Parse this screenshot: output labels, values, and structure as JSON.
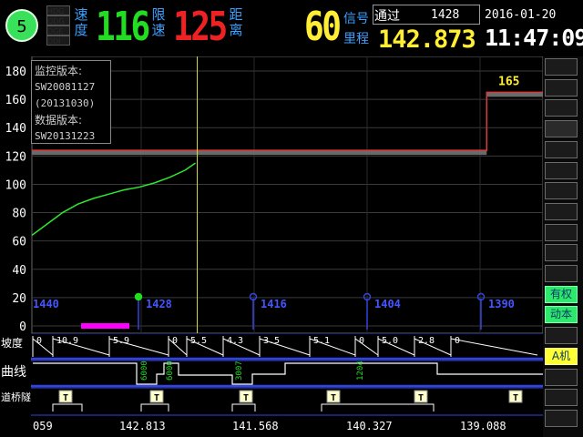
{
  "header": {
    "status_number": "5",
    "mini_labels": [
      "HDG",
      "ODG",
      "DGE",
      "DDI"
    ],
    "speed_label": "速度",
    "speed_value": "116",
    "limit_label": "限速",
    "limit_value": "125",
    "distance_label": "距离",
    "distance_value": "60",
    "signal_label": "信号",
    "mileage_label": "里程",
    "pass_label": "通过",
    "pass_value": "1428",
    "mileage_value": "142.873",
    "date": "2016-01-20",
    "time": "11:47:09"
  },
  "version_box": {
    "line1": "监控版本:",
    "line2": "SW20081127",
    "line3": "(20131030)",
    "line4": "数据版本:",
    "line5": "SW20131223"
  },
  "chart_data": {
    "type": "line",
    "y_ticks": [
      "180",
      "160",
      "140",
      "120",
      "100",
      "80",
      "60",
      "40",
      "20",
      "0"
    ],
    "ylim": [
      0,
      180
    ],
    "grid": true,
    "x_ticks": [
      "059",
      "142.813",
      "141.568",
      "140.327",
      "139.088"
    ],
    "speed_limit_label": "165",
    "signals": [
      "1440",
      "1428",
      "1416",
      "1404",
      "1390"
    ],
    "series": [
      {
        "color": "#d93b3b",
        "values": [
          {
            "x": 0,
            "y": 124
          },
          {
            "x": 0.89,
            "y": 124
          },
          {
            "x": 0.89,
            "y": 165
          },
          {
            "x": 1.0,
            "y": 165
          }
        ]
      },
      {
        "color": "#2ee82e",
        "values": [
          {
            "x": 0,
            "y": 64
          },
          {
            "x": 0.03,
            "y": 72
          },
          {
            "x": 0.06,
            "y": 80
          },
          {
            "x": 0.09,
            "y": 86
          },
          {
            "x": 0.12,
            "y": 90
          },
          {
            "x": 0.15,
            "y": 93
          },
          {
            "x": 0.18,
            "y": 96
          },
          {
            "x": 0.21,
            "y": 98
          },
          {
            "x": 0.24,
            "y": 101
          },
          {
            "x": 0.27,
            "y": 105
          },
          {
            "x": 0.3,
            "y": 110
          },
          {
            "x": 0.32,
            "y": 115
          }
        ]
      }
    ]
  },
  "tracks": {
    "label1": "坡度",
    "label2": "曲线",
    "label3": "道桥隧",
    "grade_values": [
      "0",
      "10.9",
      "5.9",
      "0",
      "5.5",
      "4.3",
      "3.5",
      "5.1",
      "0",
      "5.0",
      "2.8",
      "0"
    ],
    "curve_values": [
      "6000",
      "6000",
      "3007",
      "1204"
    ]
  },
  "sidebar": {
    "items": [
      "",
      "",
      "",
      "",
      "",
      "",
      "",
      "",
      "",
      "",
      "",
      "有权",
      "动本",
      "",
      "A机",
      "",
      "",
      ""
    ]
  }
}
